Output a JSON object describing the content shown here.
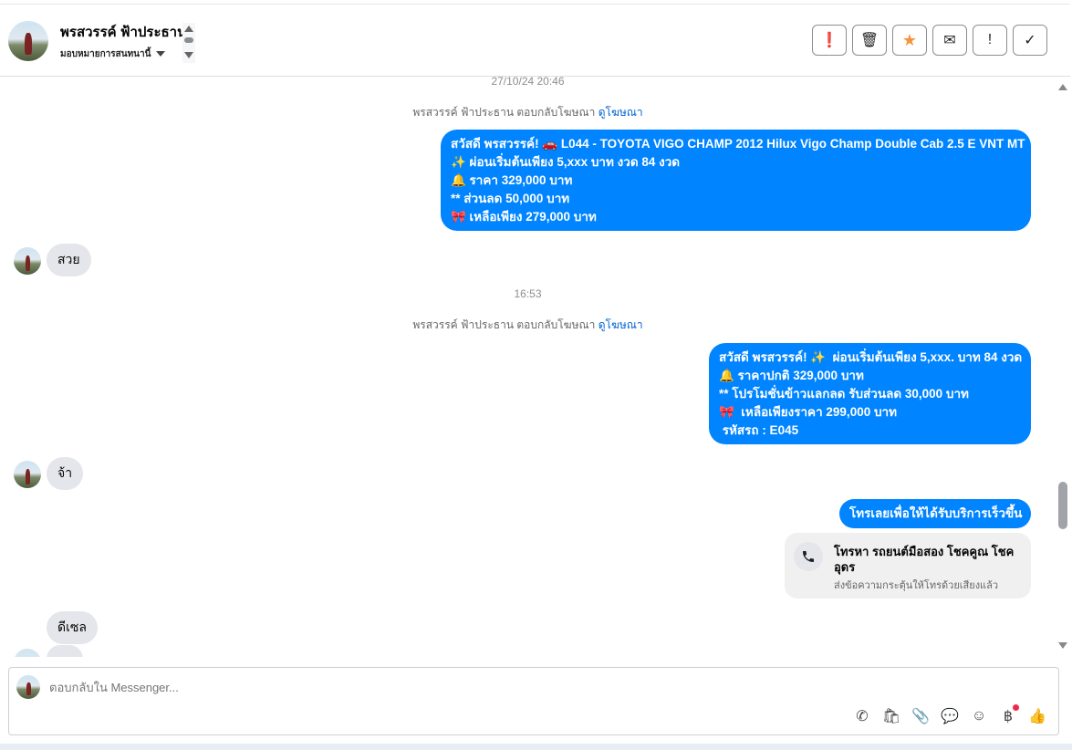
{
  "header": {
    "contact_name": "พรสวรรค์ ฟ้าประธาน",
    "assign_label": "มอบหมายการสนทนานี้",
    "actions": [
      {
        "icon": "alert-circle-icon",
        "glyph": "❗"
      },
      {
        "icon": "trash-icon",
        "glyph": "🗑"
      },
      {
        "icon": "star-icon",
        "glyph": "★"
      },
      {
        "icon": "envelope-icon",
        "glyph": "✉"
      },
      {
        "icon": "exclamation-icon",
        "glyph": "!"
      },
      {
        "icon": "check-icon",
        "glyph": "✓"
      }
    ]
  },
  "conversation": {
    "timestamp1": "27/10/24 20:46",
    "reply_note1": "พรสวรรค์ ฟ้าประธาน ตอบกลับโฆษณา",
    "reply_link1": "ดูโฆษณา",
    "message1": "สวัสดี พรสวรรค์! 🚗 L044 - TOYOTA VIGO CHAMP 2012 Hilux Vigo Champ Double Cab 2.5 E VNT MT\n✨ ผ่อนเริ่มต้นเพียง 5,xxx บาท งวด 84 งวด\n🔔 ราคา 329,000 บาท\n** ส่วนลด 50,000 บาท\n🎀 เหลือเพียง 279,000 บาท",
    "incoming1": "สวย",
    "timestamp2": "16:53",
    "reply_note2": "พรสวรรค์ ฟ้าประธาน ตอบกลับโฆษณา",
    "reply_link2": "ดูโฆษณา",
    "message2": "สวัสดี พรสวรรค์! ✨  ผ่อนเริ่มต้นเพียง 5,xxx. บาท 84 งวด\n🔔 ราคาปกติ 329,000 บาท\n** โปรโมชั่นข้าวแลกลด รับส่วนลด 30,000 บาท\n🎀  เหลือเพียงราคา 299,000 บาท\n รหัสรถ : E045",
    "incoming2": "จ้า",
    "message3": "โทรเลยเพื่อให้ได้รับบริการเร็วขึ้น",
    "call_card": {
      "title": "โทรหา รถยนต์มือสอง โชคคูณ โชค อุดร",
      "subtitle": "ส่งข้อความกระตุ้นให้โทรด้วยเสียงแล้ว"
    },
    "incoming3": "ดีเซล"
  },
  "composer": {
    "placeholder": "ตอบกลับใน Messenger..."
  },
  "tools": [
    {
      "icon": "phone-plus-icon",
      "glyph": "✆"
    },
    {
      "icon": "shopping-bag-icon",
      "glyph": "🛍"
    },
    {
      "icon": "paperclip-icon",
      "glyph": "📎"
    },
    {
      "icon": "chat-bubble-icon",
      "glyph": "💬"
    },
    {
      "icon": "emoji-icon",
      "glyph": "☺"
    },
    {
      "icon": "baht-icon",
      "glyph": "฿"
    },
    {
      "icon": "thumbs-up-icon",
      "glyph": "👍"
    }
  ]
}
